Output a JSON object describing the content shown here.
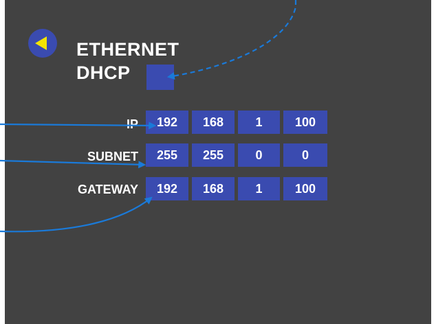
{
  "screen": {
    "background": "#424242",
    "accent": "#3a4bb0",
    "back_arrow_color": "#f4e400",
    "annotation_color": "#1a7ad9"
  },
  "header": {
    "title": "ETHERNET",
    "back_icon": "back-arrow-icon"
  },
  "dhcp": {
    "label": "DHCP",
    "checked": false
  },
  "network": {
    "ip": {
      "label": "IP",
      "octets": [
        "192",
        "168",
        "1",
        "100"
      ]
    },
    "subnet": {
      "label": "SUBNET",
      "octets": [
        "255",
        "255",
        "0",
        "0"
      ]
    },
    "gateway": {
      "label": "GATEWAY",
      "octets": [
        "192",
        "168",
        "1",
        "100"
      ]
    }
  }
}
